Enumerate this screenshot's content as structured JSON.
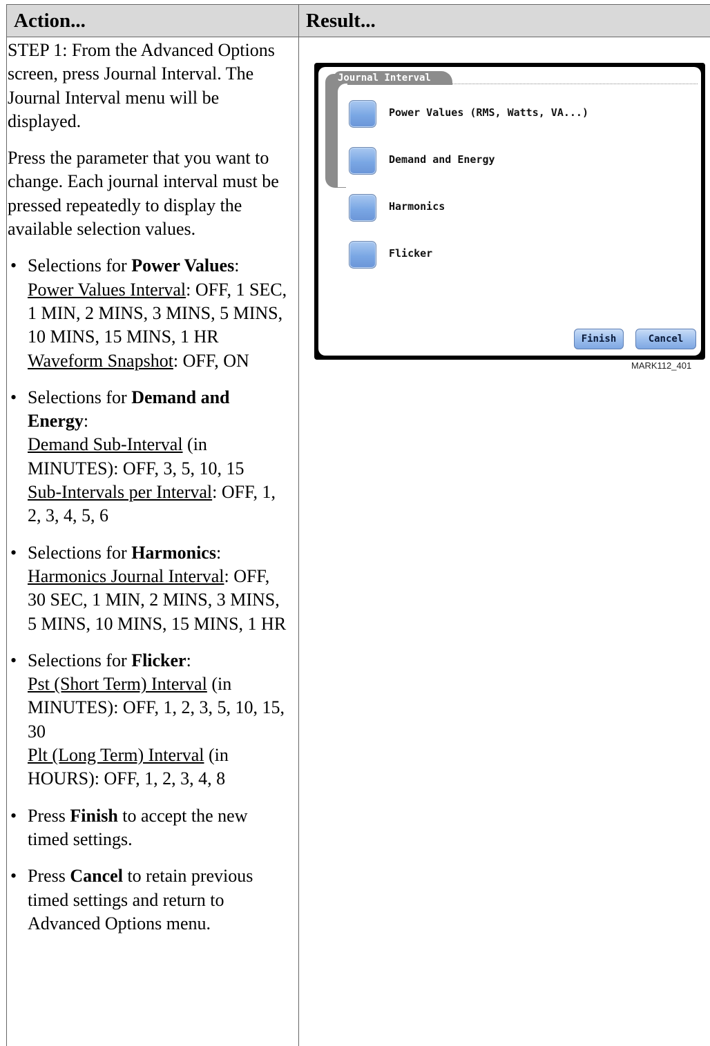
{
  "header": {
    "action": "Action...",
    "result": "Result..."
  },
  "left": {
    "step1": "STEP 1: From the Advanced Options screen, press Journal Interval. The Journal Interval menu will be displayed.",
    "para2": "Press the parameter that you want to change. Each journal interval must be pressed repeatedly to display the available selection values.",
    "bullets": [
      {
        "prefix": "Selections for ",
        "bold": "Power Values",
        "lines": [
          {
            "u": "Power Values Interval",
            "rest": ": OFF, 1 SEC, 1 MIN, 2 MINS, 3 MINS, 5 MINS, 10 MINS, 15 MINS, 1 HR"
          },
          {
            "u": "Waveform Snapshot",
            "rest": ": OFF, ON"
          }
        ]
      },
      {
        "prefix": "Selections for ",
        "bold": "Demand and Energy",
        "lines": [
          {
            "u": "Demand Sub-Interval",
            "rest": " (in MINUTES): OFF, 3, 5, 10, 15"
          },
          {
            "u": "Sub-Intervals per Interval",
            "rest": ": OFF, 1, 2, 3, 4, 5, 6"
          }
        ]
      },
      {
        "prefix": "Selections for ",
        "bold": "Harmonics",
        "lines": [
          {
            "u": "Harmonics Journal Interval",
            "rest": ": OFF, 30 SEC, 1 MIN, 2 MINS, 3 MINS, 5 MINS, 10 MINS, 15 MINS, 1 HR"
          }
        ]
      },
      {
        "prefix": "Selections for ",
        "bold": "Flicker",
        "lines": [
          {
            "u": "Pst (Short Term) Interval",
            "rest": " (in MINUTES): OFF, 1, 2, 3, 5, 10, 15, 30"
          },
          {
            "u": "Plt (Long Term) Interval",
            "rest": " (in HOURS): OFF, 1, 2, 3, 4, 8"
          }
        ]
      }
    ],
    "finish_note": {
      "pre": "Press ",
      "bold": "Finish",
      "post": " to accept the new timed settings."
    },
    "cancel_note": {
      "pre": "Press ",
      "bold": "Cancel",
      "post": " to retain previous timed settings and return to Advanced Options menu."
    }
  },
  "screen": {
    "tab_title": "Journal Interval",
    "items": [
      "Power Values (RMS, Watts, VA...)",
      "Demand and Energy",
      "Harmonics",
      "Flicker"
    ],
    "finish_label": "Finish",
    "cancel_label": "Cancel"
  },
  "caption": "MARK112_401"
}
